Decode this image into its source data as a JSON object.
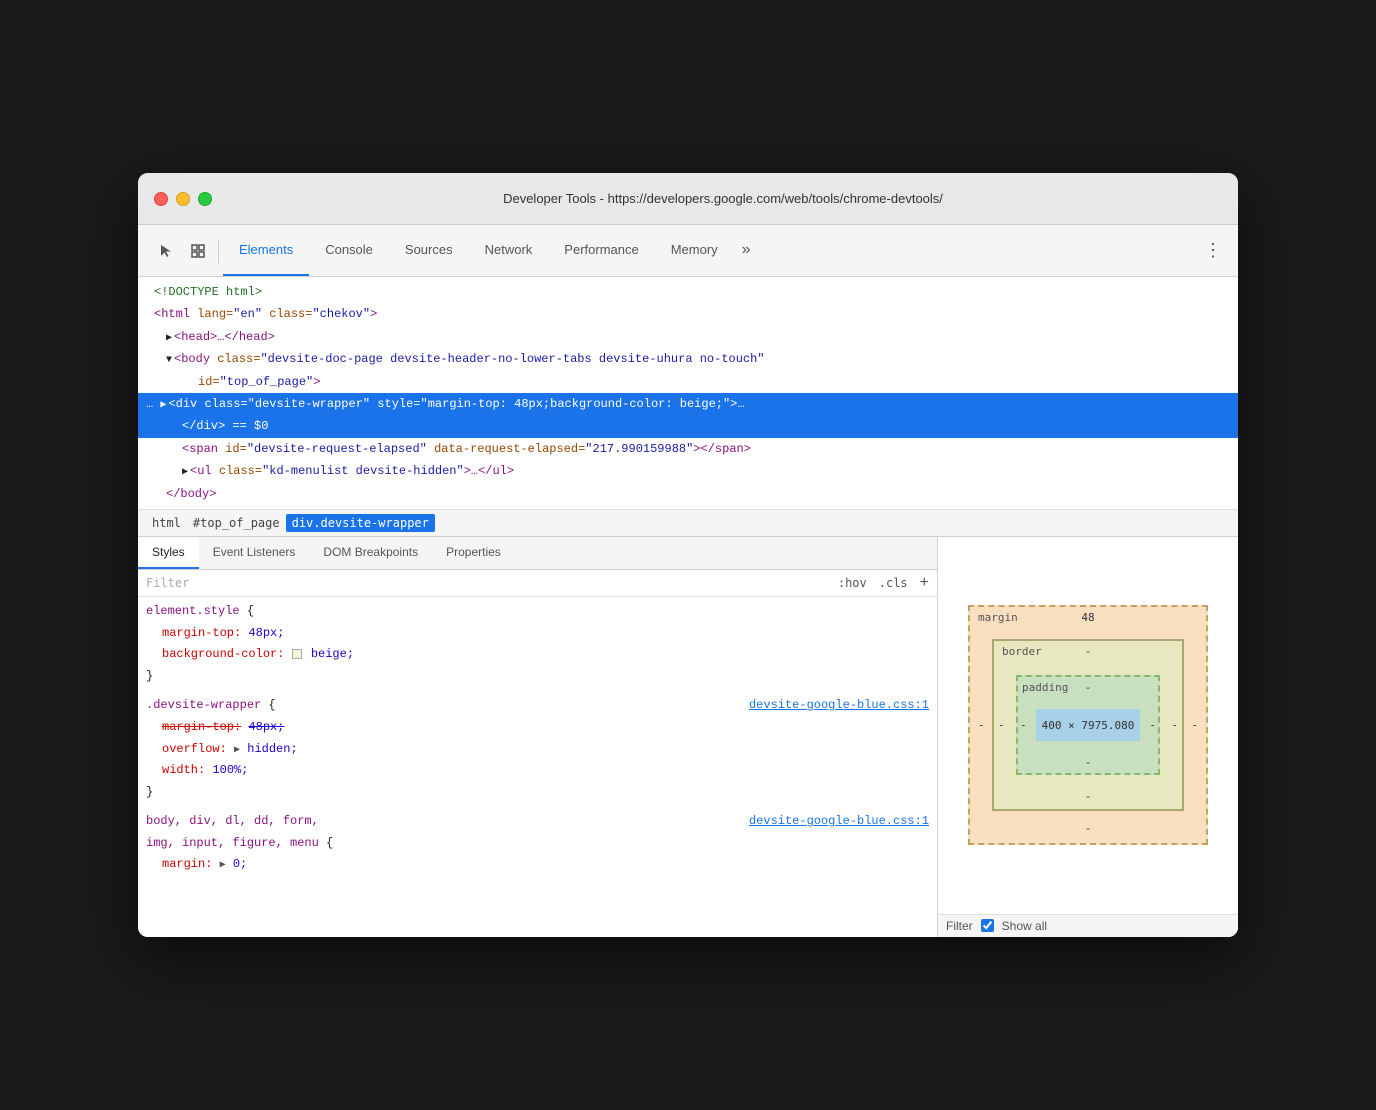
{
  "window": {
    "title": "Developer Tools - https://developers.google.com/web/tools/chrome-devtools/"
  },
  "toolbar": {
    "cursor_icon": "⬆",
    "box_icon": "☐",
    "tabs": [
      {
        "id": "elements",
        "label": "Elements",
        "active": true
      },
      {
        "id": "console",
        "label": "Console",
        "active": false
      },
      {
        "id": "sources",
        "label": "Sources",
        "active": false
      },
      {
        "id": "network",
        "label": "Network",
        "active": false
      },
      {
        "id": "performance",
        "label": "Performance",
        "active": false
      },
      {
        "id": "memory",
        "label": "Memory",
        "active": false
      }
    ],
    "more_label": "»",
    "menu_label": "⋮"
  },
  "dom": {
    "lines": [
      {
        "indent": 0,
        "text": "<!DOCTYPE html>",
        "type": "comment"
      },
      {
        "indent": 0,
        "text": "<html lang=\"en\" class=\"chekov\">",
        "type": "tag"
      },
      {
        "indent": 1,
        "text": "▶<head>…</head>",
        "type": "collapsed"
      },
      {
        "indent": 1,
        "text": "▼<body class=\"devsite-doc-page devsite-header-no-lower-tabs devsite-uhura no-touch\"",
        "type": "tag"
      },
      {
        "indent": 2,
        "text": "id=\"top_of_page\">",
        "type": "attr"
      },
      {
        "indent": 1,
        "selected": true,
        "text": "… ▶<div class=\"devsite-wrapper\" style=\"margin-top: 48px;background-color: beige;\">…",
        "type": "tag"
      },
      {
        "indent": 2,
        "text": "</div> == $0",
        "type": "tag"
      },
      {
        "indent": 2,
        "text": "<span id=\"devsite-request-elapsed\" data-request-elapsed=\"217.990159988\"></span>",
        "type": "tag"
      },
      {
        "indent": 2,
        "text": "▶<ul class=\"kd-menulist devsite-hidden\">…</ul>",
        "type": "collapsed"
      },
      {
        "indent": 1,
        "text": "</body>",
        "type": "tag"
      }
    ]
  },
  "breadcrumb": {
    "items": [
      {
        "label": "html",
        "active": false
      },
      {
        "label": "#top_of_page",
        "active": false
      },
      {
        "label": "div.devsite-wrapper",
        "active": true
      }
    ]
  },
  "panel_tabs": {
    "items": [
      {
        "label": "Styles",
        "active": true
      },
      {
        "label": "Event Listeners",
        "active": false
      },
      {
        "label": "DOM Breakpoints",
        "active": false
      },
      {
        "label": "Properties",
        "active": false
      }
    ]
  },
  "filter": {
    "placeholder": "Filter",
    "hov_label": ":hov",
    "cls_label": ".cls",
    "add_label": "+"
  },
  "styles": {
    "blocks": [
      {
        "selector": "element.style {",
        "properties": [
          {
            "name": "margin-top:",
            "value": "48px;",
            "strikethrough": false
          },
          {
            "name": "background-color:",
            "value": "beige;",
            "strikethrough": false,
            "has_swatch": true
          }
        ],
        "close": "}",
        "source": null
      },
      {
        "selector": ".devsite-wrapper {",
        "properties": [
          {
            "name": "margin-top:",
            "value": "48px;",
            "strikethrough": true
          },
          {
            "name": "overflow:",
            "value": "hidden;",
            "strikethrough": false,
            "has_arrow": true
          },
          {
            "name": "width:",
            "value": "100%;",
            "strikethrough": false
          }
        ],
        "close": "}",
        "source": "devsite-google-blue.css:1"
      },
      {
        "selector": "body, div, dl, dd, form,",
        "selector2": "img, input, figure, menu {",
        "properties": [
          {
            "name": "margin:",
            "value": "▶ 0;",
            "strikethrough": false,
            "has_arrow": true
          }
        ],
        "source": "devsite-google-blue.css:1"
      }
    ]
  },
  "box_model": {
    "margin_label": "margin",
    "margin_top": "48",
    "margin_other": "-",
    "border_label": "border",
    "border_value": "-",
    "padding_label": "padding",
    "padding_value": "-",
    "content_size": "400 × 7975.080",
    "bottom_dash": "-",
    "outer_dash": "-"
  },
  "bottom_filter": {
    "label": "Filter",
    "show_all_label": "Show all"
  }
}
